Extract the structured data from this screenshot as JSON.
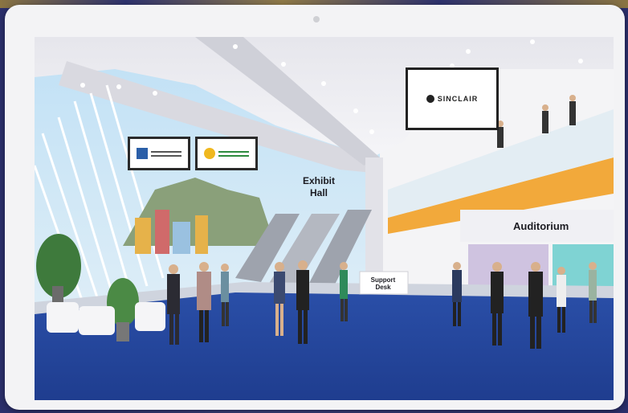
{
  "venue": {
    "exhibit_hall_label": "Exhibit\nHall",
    "auditorium_label": "Auditorium",
    "support_desk_label": "Support\nDesk",
    "screens": {
      "main_sponsor": "SINCLAIR"
    }
  },
  "colors": {
    "carpet": "#2346a0",
    "balcony_accent": "#f2a93b",
    "frame": "#f3f3f5",
    "backdrop": "#2b2f6b"
  }
}
